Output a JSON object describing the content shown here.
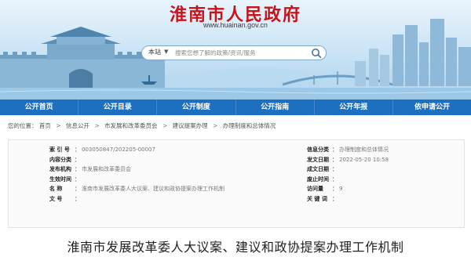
{
  "header": {
    "title": "淮南市人民政府",
    "url": "www.huainan.gov.cn"
  },
  "search": {
    "scope": "本站",
    "placeholder": "搜索您想了解的政策/资讯/服务"
  },
  "nav": {
    "items": [
      "公开首页",
      "公开目录",
      "公开制度",
      "公开指南",
      "公开年报",
      "依申请公开"
    ]
  },
  "breadcrumb": {
    "prefix": "您的位置：",
    "items": [
      "首页",
      "信息公开",
      "市发展和改革委员会",
      "建议提案办理",
      "办理制度和总体情况"
    ],
    "separator": ">"
  },
  "info": {
    "left": [
      {
        "label": "索  引  号",
        "value": "003050847/202205-00007"
      },
      {
        "label": "内容分类",
        "value": ""
      },
      {
        "label": "发布机构",
        "value": "市发展和改革委员会"
      },
      {
        "label": "生效时间",
        "value": ""
      },
      {
        "label": "名        称",
        "value": "淮南市发展改革委人大议案、建议和政协提案办理工作机制"
      },
      {
        "label": "文        号",
        "value": ""
      }
    ],
    "right": [
      {
        "label": "信息分类",
        "value": "办理制度和总体情况"
      },
      {
        "label": "发文日期",
        "value": "2022-05-20 10:58"
      },
      {
        "label": "成文日期",
        "value": ""
      },
      {
        "label": "废止时间",
        "value": ""
      },
      {
        "label": "访问量",
        "value": "9"
      },
      {
        "label": "关  键  词",
        "value": ""
      }
    ]
  },
  "article": {
    "title": "淮南市发展改革委人大议案、建议和政协提案办理工作机制"
  },
  "colors": {
    "nav_bg": "#1d6fc0",
    "title_red": "#c8131b",
    "banner_light": "#e9f4fc",
    "banner_dark": "#a9d2ee"
  },
  "icons": {
    "search_button": "search-icon",
    "scope_dropdown": "caret-down-icon"
  }
}
